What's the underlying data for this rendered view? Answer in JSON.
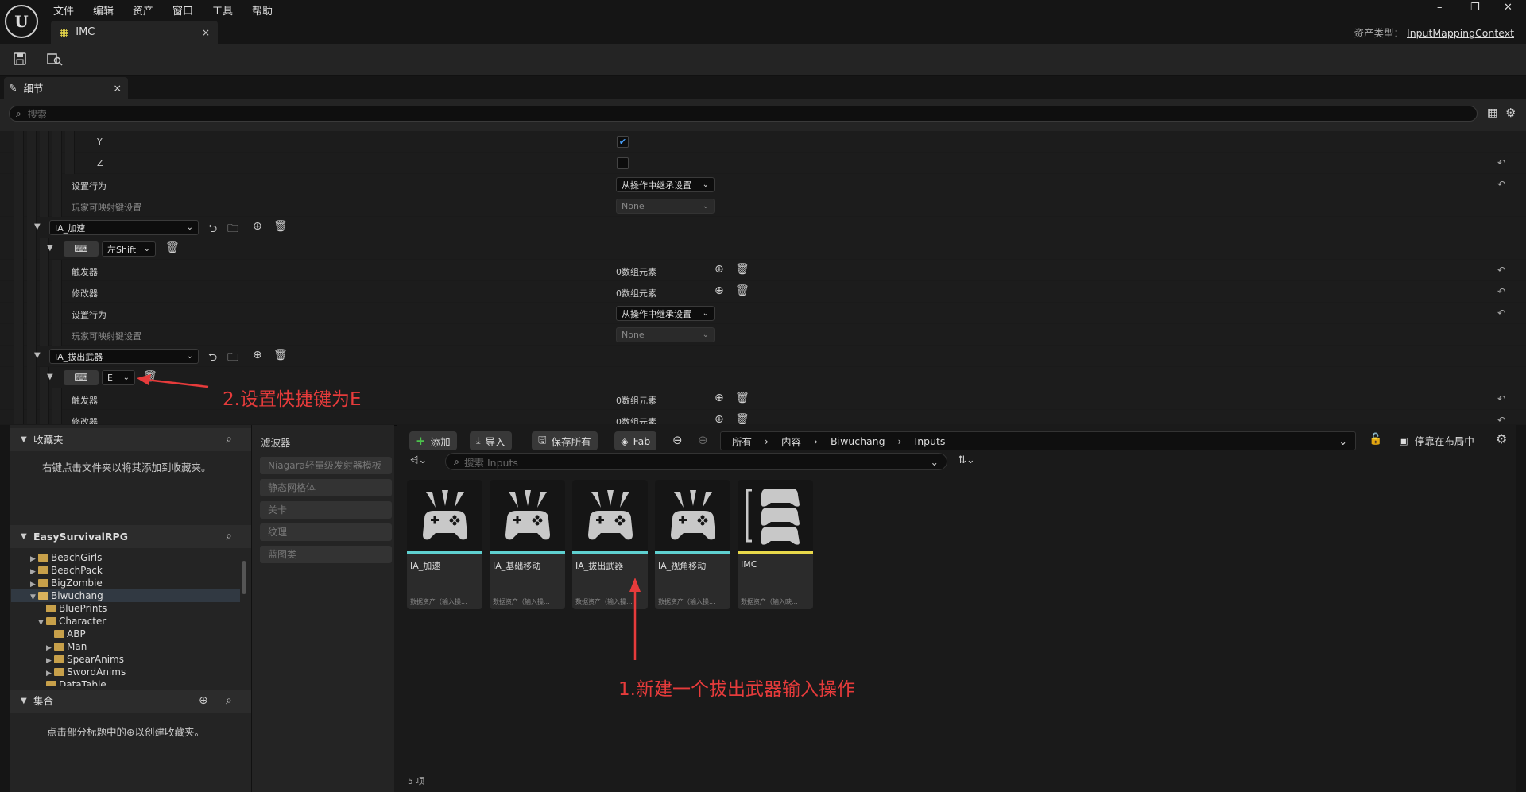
{
  "menu": [
    "文件",
    "编辑",
    "资产",
    "窗口",
    "工具",
    "帮助"
  ],
  "tab": {
    "label": "IMC",
    "close": "×"
  },
  "window_controls": {
    "minimize": "–",
    "restore": "❐",
    "close": "✕"
  },
  "asset_type": {
    "label": "资产类型：",
    "value": "InputMappingContext"
  },
  "details_tab": {
    "label": "细节",
    "close": "×"
  },
  "details_search_placeholder": "搜索",
  "details": {
    "y_label": "Y",
    "z_label": "Z",
    "behavior_label": "设置行为",
    "behavior_value": "从操作中继承设置",
    "player_map_label": "玩家可映射键设置",
    "player_map_value": "None",
    "action1": "IA_加速",
    "key1": "左Shift",
    "triggers_label": "触发器",
    "modifiers_label": "修改器",
    "array_value": "0数组元素",
    "action2": "IA_拔出武器",
    "key2": "E"
  },
  "annotations": {
    "step2": "2.设置快捷键为E",
    "step1": "1.新建一个拔出武器输入操作"
  },
  "favorites": {
    "title": "收藏夹",
    "hint": "右键点击文件夹以将其添加到收藏夹。"
  },
  "project": {
    "title": "EasySurvivalRPG",
    "tree": [
      "BeachGirls",
      "BeachPack",
      "BigZombie",
      "Biwuchang",
      "BluePrints",
      "Character",
      "ABP",
      "Man",
      "SpearAnims",
      "SwordAnims",
      "DataTable"
    ]
  },
  "collections": {
    "title": "集合",
    "hint_before": "点击部分标题中的",
    "hint_after": "以创建收藏夹。"
  },
  "filters": {
    "title": "滤波器",
    "items": [
      "Niagara轻量级发射器模板",
      "静态网格体",
      "关卡",
      "纹理",
      "蓝图类"
    ]
  },
  "cb_toolbar": {
    "add": "添加",
    "import": "导入",
    "save_all": "保存所有",
    "fab": "Fab",
    "dock": "停靠在布局中"
  },
  "path": [
    "所有",
    "内容",
    "Biwuchang",
    "Inputs"
  ],
  "cb_search_placeholder": "搜索 Inputs",
  "assets": [
    {
      "name": "IA_加速",
      "type": "数据资产（输入操...",
      "color": "#5fd1d1"
    },
    {
      "name": "IA_基础移动",
      "type": "数据资产（输入操...",
      "color": "#5fd1d1"
    },
    {
      "name": "IA_拔出武器",
      "type": "数据资产（输入操...",
      "color": "#5fd1d1"
    },
    {
      "name": "IA_视角移动",
      "type": "数据资产（输入操...",
      "color": "#5fd1d1"
    },
    {
      "name": "IMC",
      "type": "数据资产（输入映...",
      "color": "#e8d84a"
    }
  ],
  "item_count": "5 项"
}
